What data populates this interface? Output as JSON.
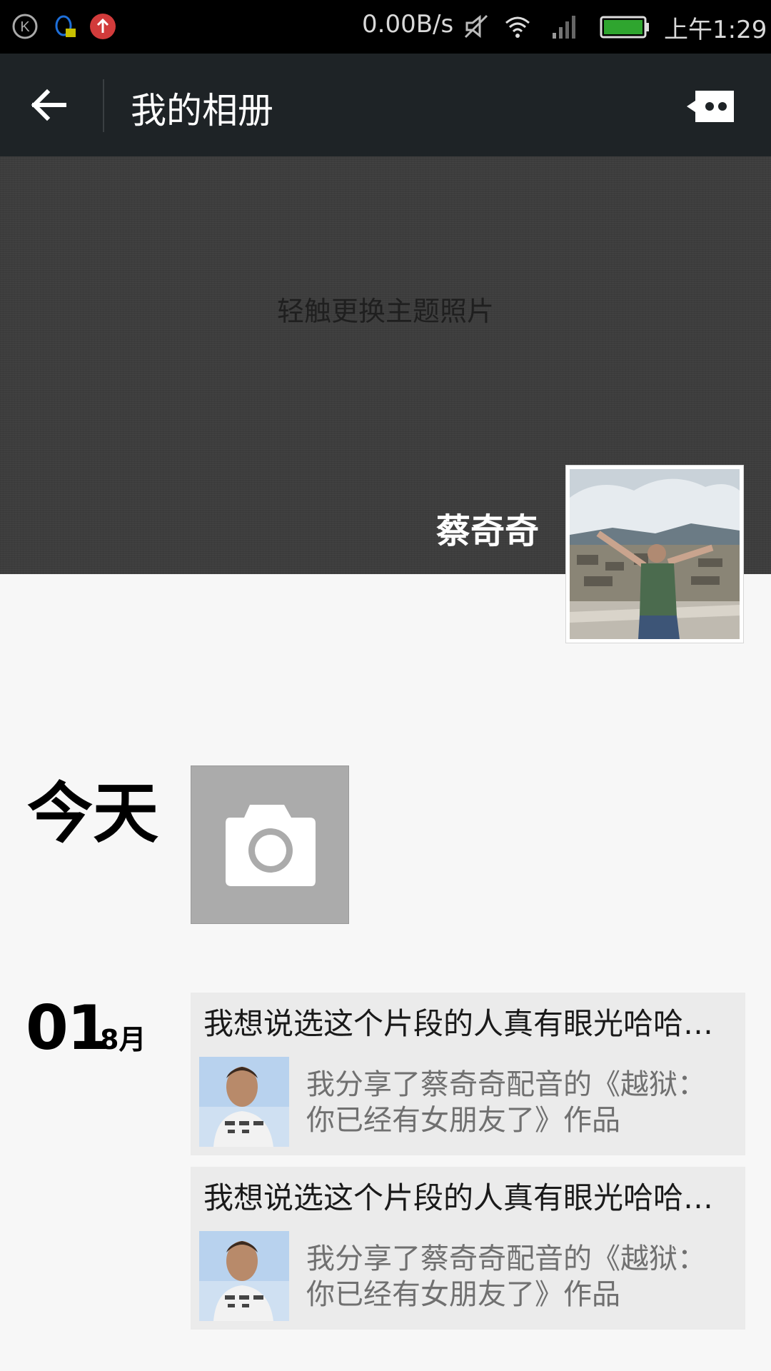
{
  "status_bar": {
    "speed": "0.00B/s",
    "time": "上午1:29",
    "icons": [
      "k-app-icon",
      "qq-notification-icon",
      "upload-icon",
      "mute-icon",
      "wifi-icon",
      "signal-icon",
      "battery-icon"
    ]
  },
  "header": {
    "title": "我的相册",
    "back_icon": "back-arrow-icon",
    "more_icon": "more-comment-icon"
  },
  "cover": {
    "hint": "轻触更换主题照片",
    "username": "蔡奇奇"
  },
  "today": {
    "label": "今天",
    "camera_icon": "camera-icon"
  },
  "date_group": {
    "day": "01",
    "month": "8月"
  },
  "posts": [
    {
      "title": "我想说选这个片段的人真有眼光哈哈哈哈哈",
      "share_text": "我分享了蔡奇奇配音的《越狱：你已经有女朋友了》作品"
    },
    {
      "title": "我想说选这个片段的人真有眼光哈哈哈哈哈",
      "share_text": "我分享了蔡奇奇配音的《越狱：你已经有女朋友了》作品"
    }
  ],
  "colors": {
    "title_bar": "#1e2326",
    "cover": "#3d3d3d",
    "post_bg": "#ebebeb",
    "page_bg": "#f7f7f7"
  }
}
